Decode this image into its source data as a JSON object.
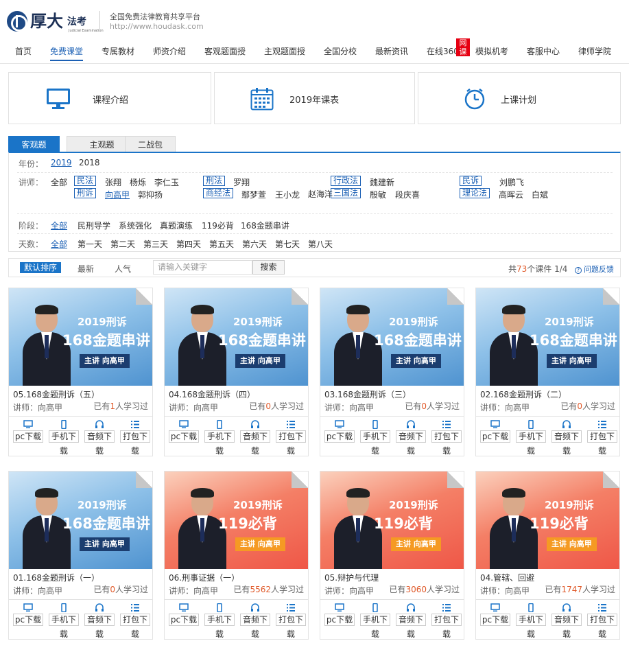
{
  "header": {
    "logo_text": "厚大",
    "logo_sub": "法考",
    "logo_tiny": "Judicial Examination",
    "slogan": "全国免费法律教育共享平台",
    "url": "http://www.houdask.com"
  },
  "nav": {
    "items": [
      "首页",
      "免费课堂",
      "专属教材",
      "师资介绍",
      "客观题面授",
      "主观题面授",
      "全国分校",
      "最新资讯",
      "在线360",
      "模拟机考",
      "客服中心",
      "律师学院"
    ],
    "active": "免费课堂",
    "badge": "网课"
  },
  "tiles": [
    {
      "label": "课程介绍",
      "icon": "monitor-icon"
    },
    {
      "label": "2019年课表",
      "icon": "calendar-icon"
    },
    {
      "label": "上课计划",
      "icon": "clock-icon"
    }
  ],
  "tabs": [
    "客观题",
    "主观题",
    "二战包"
  ],
  "filter": {
    "year_label": "年份：",
    "years": [
      "2019",
      "2018"
    ],
    "teacher_label": "讲师：",
    "all": "全部",
    "subjects": [
      "民法",
      "刑诉",
      "刑法",
      "商经法",
      "行政法",
      "三国法",
      "民诉",
      "理论法"
    ],
    "teachers": {
      "minfa": [
        "张翔",
        "杨烁",
        "李仁玉"
      ],
      "xingsu": [
        "向高甲",
        "郭抑扬"
      ],
      "xingfa": [
        "罗翔"
      ],
      "shangjing": [
        "鄢梦萱",
        "王小龙",
        "赵海洋"
      ],
      "xingzheng": [
        "魏建新"
      ],
      "sanguo": [
        "殷敏",
        "段庆喜"
      ],
      "minsu": [
        "刘鹏飞"
      ],
      "lilun": [
        "高晖云",
        "白斌"
      ]
    },
    "stage_label": "阶段：",
    "stages": [
      "全部",
      "民刑导学",
      "系统强化",
      "真题演练",
      "119必背",
      "168金题串讲"
    ],
    "day_label": "天数：",
    "days": [
      "全部",
      "第一天",
      "第二天",
      "第三天",
      "第四天",
      "第五天",
      "第六天",
      "第七天",
      "第八天"
    ]
  },
  "sortbar": {
    "default": "默认排序",
    "newest": "最新",
    "popular": "人气",
    "search_placeholder": "请输入关键字",
    "search_button": "搜索",
    "count_prefix": "共",
    "count_total": "73",
    "count_mid": "个课件 ",
    "page": "1/4",
    "feedback": "问题反馈"
  },
  "download": {
    "pc": "pc下载",
    "mobile": "手机下",
    "audio": "音频下",
    "pack": "打包下",
    "wrap": "载"
  },
  "courses": [
    {
      "title": "05.168金题刑诉（五）",
      "teacher": "讲师：向高甲",
      "learn_prefix": "已有",
      "learn_count": "1",
      "learn_suffix": "人学习过",
      "theme": "blue",
      "line1": "2019刑诉",
      "line2": "168金题串讲",
      "pill": "主讲 向高甲"
    },
    {
      "title": "04.168金题刑诉（四）",
      "teacher": "讲师：向高甲",
      "learn_prefix": "已有",
      "learn_count": "0",
      "learn_suffix": "人学习过",
      "theme": "blue",
      "line1": "2019刑诉",
      "line2": "168金题串讲",
      "pill": "主讲 向高甲"
    },
    {
      "title": "03.168金题刑诉（三）",
      "teacher": "讲师：向高甲",
      "learn_prefix": "已有",
      "learn_count": "0",
      "learn_suffix": "人学习过",
      "theme": "blue",
      "line1": "2019刑诉",
      "line2": "168金题串讲",
      "pill": "主讲 向高甲"
    },
    {
      "title": "02.168金题刑诉（二）",
      "teacher": "讲师：向高甲",
      "learn_prefix": "已有",
      "learn_count": "0",
      "learn_suffix": "人学习过",
      "theme": "blue",
      "line1": "2019刑诉",
      "line2": "168金题串讲",
      "pill": "主讲 向高甲"
    },
    {
      "title": "01.168金题刑诉（一）",
      "teacher": "讲师：向高甲",
      "learn_prefix": "已有",
      "learn_count": "0",
      "learn_suffix": "人学习过",
      "theme": "blue",
      "line1": "2019刑诉",
      "line2": "168金题串讲",
      "pill": "主讲 向高甲"
    },
    {
      "title": "06.刑事证据（一）",
      "teacher": "讲师：向高甲",
      "learn_prefix": "已有",
      "learn_count": "5562",
      "learn_suffix": "人学习过",
      "theme": "red",
      "line1": "2019刑诉",
      "line2": "119必背",
      "pill": "主讲 向高甲"
    },
    {
      "title": "05.辩护与代理",
      "teacher": "讲师：向高甲",
      "learn_prefix": "已有",
      "learn_count": "3060",
      "learn_suffix": "人学习过",
      "theme": "red",
      "line1": "2019刑诉",
      "line2": "119必背",
      "pill": "主讲 向高甲"
    },
    {
      "title": "04.管辖、回避",
      "teacher": "讲师：向高甲",
      "learn_prefix": "已有",
      "learn_count": "1747",
      "learn_suffix": "人学习过",
      "theme": "red",
      "line1": "2019刑诉",
      "line2": "119必背",
      "pill": "主讲 向高甲"
    }
  ]
}
